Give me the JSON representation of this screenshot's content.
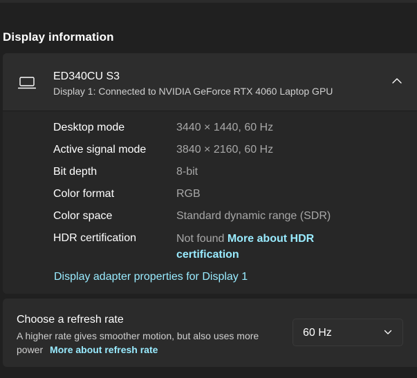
{
  "section_title": "Display information",
  "monitor": {
    "name": "ED340CU S3",
    "description": "Display 1: Connected to NVIDIA GeForce RTX 4060 Laptop GPU"
  },
  "info_rows": [
    {
      "label": "Desktop mode",
      "value": "3440 × 1440, 60 Hz"
    },
    {
      "label": "Active signal mode",
      "value": "3840 × 2160, 60 Hz"
    },
    {
      "label": "Bit depth",
      "value": "8-bit"
    },
    {
      "label": "Color format",
      "value": "RGB"
    },
    {
      "label": "Color space",
      "value": "Standard dynamic range (SDR)"
    }
  ],
  "hdr": {
    "label": "HDR certification",
    "value": "Not found",
    "link": "More about HDR certification"
  },
  "adapter_link": "Display adapter properties for Display 1",
  "refresh": {
    "title": "Choose a refresh rate",
    "description": "A higher rate gives smoother motion, but also uses more power",
    "link": "More about refresh rate",
    "selected": "60 Hz"
  },
  "icons": {
    "monitor": "laptop-icon",
    "expand": "chevron-up-icon",
    "dropdown": "chevron-down-icon"
  },
  "colors": {
    "accent_link": "#99ebff",
    "background": "#202020",
    "card": "#2b2b2b"
  }
}
